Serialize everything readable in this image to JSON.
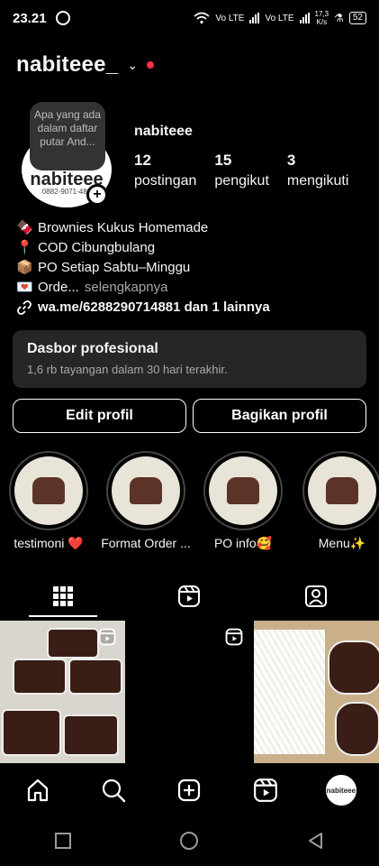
{
  "status_bar": {
    "time": "23.21",
    "network_1": "Vo LTE",
    "network_2": "Vo LTE",
    "speed_value": "17,3",
    "speed_unit": "K/s",
    "battery": "52"
  },
  "header": {
    "username": "nabiteee_",
    "has_notification_dot": true,
    "accent_color": "#ff3040"
  },
  "avatar": {
    "note": "Apa yang ada dalam daftar putar And...",
    "brand_text": "nabiteee",
    "phone_text": "0882-9071-488"
  },
  "profile": {
    "display_name": "nabiteee",
    "stats": [
      {
        "value": "12",
        "label": "postingan"
      },
      {
        "value": "15",
        "label": "pengikut"
      },
      {
        "value": "3",
        "label": "mengikuti"
      }
    ]
  },
  "bio": {
    "line1_emoji": "🍫",
    "line1": "Brownies Kukus Homemade",
    "line2_emoji": "📍",
    "line2": "COD Cibungbulang",
    "line3_emoji": "📦",
    "line3": "PO Setiap Sabtu–Minggu",
    "line4_emoji": "💌",
    "line4": "Orde...",
    "line4_more": "selengkapnya",
    "link": "wa.me/6288290714881 dan 1 lainnya"
  },
  "dashboard": {
    "title": "Dasbor profesional",
    "subtitle": "1,6 rb tayangan dalam 30 hari terakhir."
  },
  "buttons": {
    "edit": "Edit profil",
    "share": "Bagikan profil"
  },
  "highlights": [
    {
      "label": "testimoni ❤️"
    },
    {
      "label": "Format Order ..."
    },
    {
      "label": "PO info🥰"
    },
    {
      "label": "Menu✨"
    }
  ],
  "tabs": [
    {
      "icon": "grid-icon",
      "active": true
    },
    {
      "icon": "reels-icon",
      "active": false
    },
    {
      "icon": "tagged-icon",
      "active": false
    }
  ],
  "posts": [
    {
      "type": "reel"
    },
    {
      "type": "reel"
    },
    {
      "type": "photo"
    }
  ],
  "bottom_nav": [
    {
      "icon": "home-icon"
    },
    {
      "icon": "search-icon"
    },
    {
      "icon": "create-icon"
    },
    {
      "icon": "reels-icon"
    },
    {
      "icon": "profile-avatar",
      "text": "nabiteee"
    }
  ],
  "system_nav": [
    {
      "icon": "recents-icon"
    },
    {
      "icon": "home-circle-icon"
    },
    {
      "icon": "back-icon"
    }
  ]
}
